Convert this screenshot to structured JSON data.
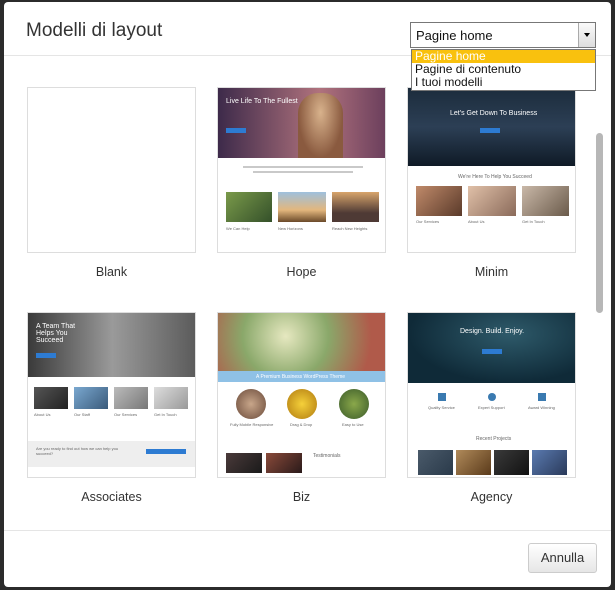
{
  "dialog": {
    "title": "Modelli di layout"
  },
  "filter": {
    "selected": "Pagine home",
    "options": [
      "Pagine home",
      "Pagine di contenuto",
      "I tuoi modelli"
    ]
  },
  "templates": [
    {
      "name": "Blank"
    },
    {
      "name": "Hope",
      "hero_text": "Live Life To The Fullest",
      "captions": [
        "We Can Help",
        "New Horizons",
        "Reach New Heights"
      ]
    },
    {
      "name": "Minim",
      "hero_text": "Let's Get Down To Business",
      "section_title": "We're Here To Help You Succeed",
      "captions": [
        "Our Services",
        "About Us",
        "Get In Touch"
      ]
    },
    {
      "name": "Associates",
      "hero_text": "A Team That Helps You Succeed",
      "captions": [
        "About Us",
        "Our Staff",
        "Our Services",
        "Get In Touch"
      ],
      "cta": "Are you ready to find out how we can help you succeed?"
    },
    {
      "name": "Biz",
      "banner_text": "A Premium Business WordPress Theme",
      "captions": [
        "Fully Mobile Responsive",
        "Drag & Drop",
        "Easy to Use"
      ],
      "testimonials": "Testimonials"
    },
    {
      "name": "Agency",
      "hero_text": "Design. Build. Enjoy.",
      "captions": [
        "Quality Service",
        "Expert Support",
        "Award Winning"
      ],
      "section_title": "Recent Projects"
    }
  ],
  "footer": {
    "cancel_label": "Annulla"
  }
}
